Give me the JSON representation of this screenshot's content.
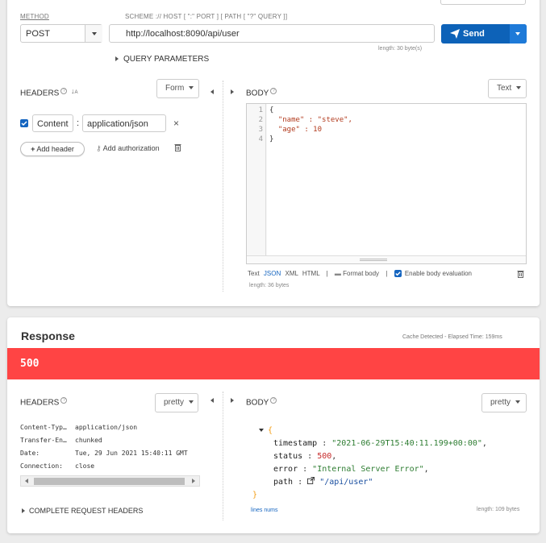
{
  "request": {
    "method_label": "METHOD",
    "method_value": "POST",
    "scheme_label": "SCHEME :// HOST [ \":\" PORT ] [ PATH [ \"?\" QUERY ]]",
    "url_value": "http://localhost:8090/api/user",
    "url_length": "length: 30 byte(s)",
    "send_label": "Send",
    "query_params_label": "QUERY PARAMETERS",
    "headers_title": "HEADERS",
    "headers_mode": "Form",
    "header_rows": [
      {
        "name": "Content",
        "value": "application/json",
        "checked": true
      }
    ],
    "add_header_label": "Add header",
    "add_auth_label": "Add authorization",
    "body_title": "BODY",
    "body_mode": "Text",
    "body_lines": [
      {
        "num": "1",
        "text": "{"
      },
      {
        "num": "2",
        "text": "  \"name\" : \"steve\","
      },
      {
        "num": "3",
        "text": "  \"age\" : 10"
      },
      {
        "num": "4",
        "text": "}"
      }
    ],
    "format_options": [
      "Text",
      "JSON",
      "XML",
      "HTML"
    ],
    "format_body_label": "Format body",
    "enable_eval_label": "Enable body evaluation",
    "body_length": "length: 36 bytes"
  },
  "response": {
    "title": "Response",
    "cache_info": "Cache Detected - Elapsed Time: 159ms",
    "status_code": "500",
    "status_color": "#ff4444",
    "headers_title": "HEADERS",
    "headers_mode": "pretty",
    "headers": [
      {
        "name": "Content-Typ…",
        "value": "application/json"
      },
      {
        "name": "Transfer-En…",
        "value": "chunked"
      },
      {
        "name": "Date:",
        "value": "Tue, 29 Jun 2021 15:40:11 GMT"
      },
      {
        "name": "Connection:",
        "value": "close"
      }
    ],
    "complete_headers_label": "COMPLETE REQUEST HEADERS",
    "body_title": "BODY",
    "body_mode": "pretty",
    "json": [
      {
        "key": "timestamp",
        "value": "\"2021-06-29T15:40:11.199+00:00\"",
        "type": "string"
      },
      {
        "key": "status",
        "value": "500",
        "type": "number"
      },
      {
        "key": "error",
        "value": "\"Internal Server Error\"",
        "type": "string"
      },
      {
        "key": "path",
        "value": "\"/api/user\"",
        "type": "link"
      }
    ],
    "line_nums_label": "lines nums",
    "body_length": "length: 109 bytes"
  },
  "colors": {
    "accent": "#1565c0",
    "send_bg": "#0d62b8",
    "string_color": "#2e7d32",
    "number_color": "#c62828",
    "link_color": "#1a4fa0",
    "brace_color": "#f39c12"
  }
}
